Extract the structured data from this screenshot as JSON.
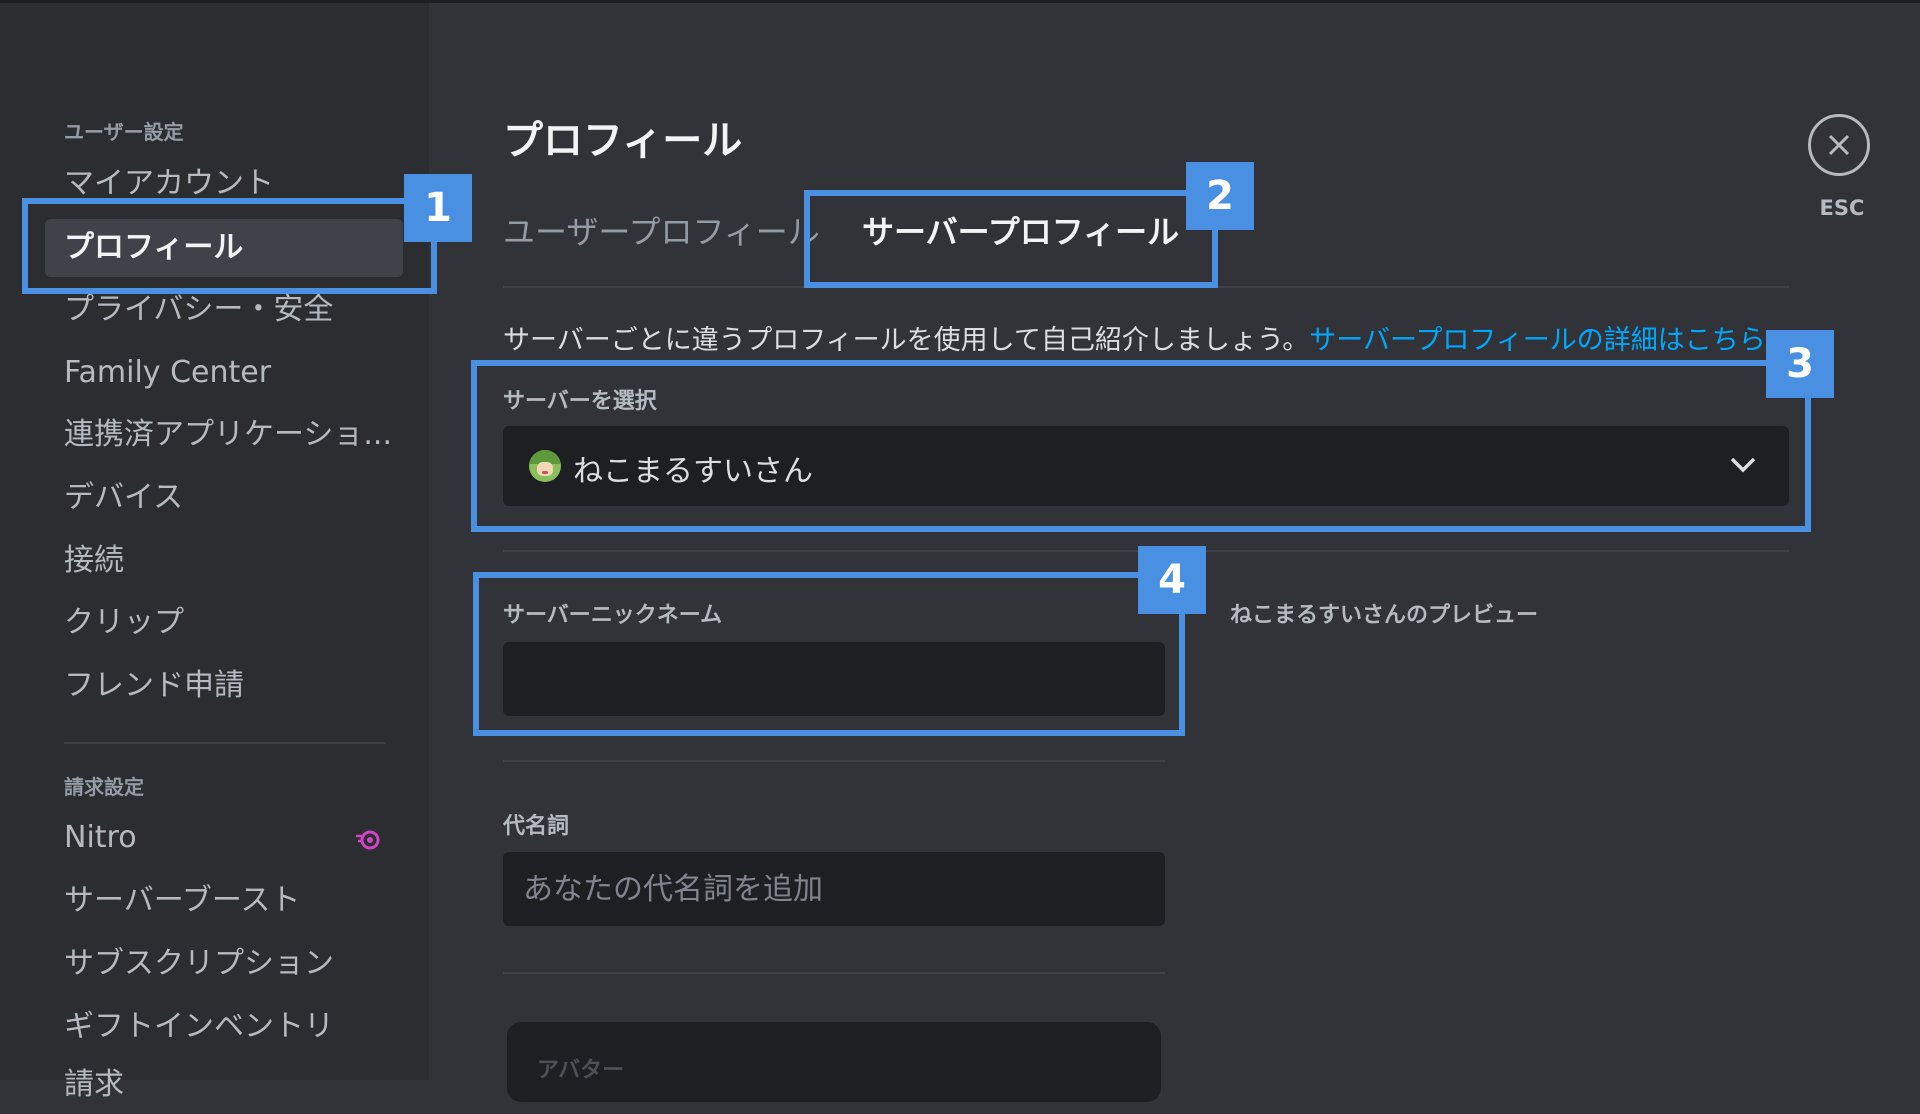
{
  "sidebar": {
    "user_settings_header": "ユーザー設定",
    "user_items": [
      {
        "label": "マイアカウント"
      },
      {
        "label": "プロフィール"
      },
      {
        "label": "プライバシー・安全"
      },
      {
        "label": "Family Center"
      },
      {
        "label": "連携済アプリケーショ..."
      },
      {
        "label": "デバイス"
      },
      {
        "label": "接続"
      },
      {
        "label": "クリップ"
      },
      {
        "label": "フレンド申請"
      }
    ],
    "selected_index": 1,
    "billing_header": "請求設定",
    "billing_items": [
      {
        "label": "Nitro",
        "badge_icon": "nitro-icon"
      },
      {
        "label": "サーバーブースト"
      },
      {
        "label": "サブスクリプション"
      },
      {
        "label": "ギフトインベントリ"
      },
      {
        "label": "請求"
      }
    ]
  },
  "main": {
    "title": "プロフィール",
    "tabs": [
      {
        "label": "ユーザープロフィール",
        "active": false
      },
      {
        "label": "サーバープロフィール",
        "active": true
      }
    ],
    "description": "サーバーごとに違うプロフィールを使用して自己紹介しましょう。",
    "description_link": "サーバープロフィールの詳細はこちら。",
    "select_server_label": "サーバーを選択",
    "selected_server": "ねこまるすいさん",
    "nickname_label": "サーバーニックネーム",
    "nickname_value": "",
    "preview_label": "ねこまるすいさんのプレビュー",
    "pronouns_label": "代名詞",
    "pronouns_placeholder": "あなたの代名詞を追加",
    "avatar_label": "アバター"
  },
  "close": {
    "esc_label": "ESC"
  },
  "annotations": [
    "1",
    "2",
    "3",
    "4"
  ],
  "colors": {
    "background": "#313338",
    "sidebar": "#2b2d31",
    "input": "#1e1f22",
    "link": "#00a8fc",
    "annotation": "#4a90e2",
    "nitro": "#d442c8"
  }
}
